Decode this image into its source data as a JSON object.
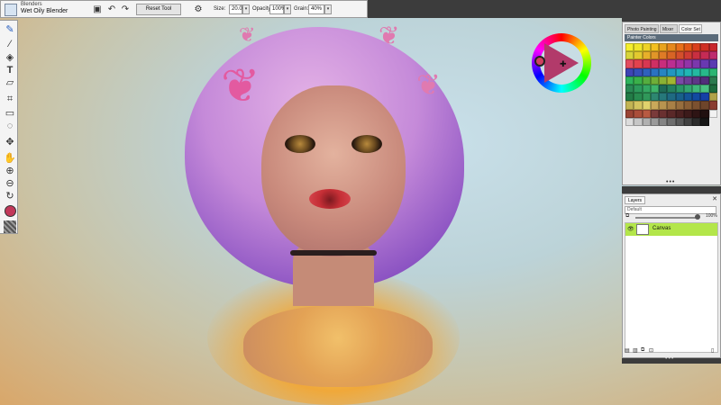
{
  "brush": {
    "category": "Blenders",
    "variant": "Wet Oily Blender",
    "icon": "brush-icon"
  },
  "propbar": {
    "reset_label": "Reset Tool",
    "size_label": "Size:",
    "size_value": "20.0",
    "opacity_label": "Opacity:",
    "opacity_value": "100%",
    "grain_label": "Grain:",
    "grain_value": "40%"
  },
  "toolbox": [
    "brush-icon",
    "dropper-icon",
    "paint-bucket-icon",
    "text-icon",
    "eraser-icon",
    "crop-icon",
    "rectangle-select-icon",
    "lasso-icon",
    "layer-adjuster-icon",
    "transform-icon",
    "grabber-icon",
    "magnifier-icon",
    "zoom-out-icon",
    "rotate-icon",
    "main-color-icon",
    "paper-icon"
  ],
  "color_panel": {
    "tabs": [
      "Photo Painting",
      "Mixer",
      "Color Set"
    ],
    "active_tab": "Color Set",
    "header": "Painter Colors",
    "swatches": [
      "#f5ef2d",
      "#f0e62a",
      "#eed327",
      "#f3c020",
      "#e8a31e",
      "#e6881c",
      "#e8701a",
      "#e25818",
      "#d9401d",
      "#cf2f24",
      "#c8262c",
      "#d8d43a",
      "#e3c92f",
      "#e7b02a",
      "#e19628",
      "#df7b26",
      "#d86425",
      "#d44f2c",
      "#cf3c34",
      "#c92f41",
      "#c52b55",
      "#be2b6e",
      "#e34c5e",
      "#e3424e",
      "#d93752",
      "#d02f63",
      "#c82d7c",
      "#bb2e91",
      "#a8309f",
      "#9234a8",
      "#7c37ad",
      "#6938b1",
      "#5a3bb2",
      "#3e44b4",
      "#3550b8",
      "#2f61bd",
      "#2a72c0",
      "#2785c1",
      "#2396c0",
      "#21a7bd",
      "#21b6b4",
      "#24b9a1",
      "#27b88a",
      "#2bb572",
      "#2eb35c",
      "#3ab04a",
      "#55ad3f",
      "#6fae38",
      "#8ab234",
      "#a2b631",
      "#7a4aa6",
      "#6c3f97",
      "#5e3688",
      "#512d7a",
      "#2b7a4e",
      "#2a8a55",
      "#2d9a5c",
      "#35a862",
      "#3fb56a",
      "#1f6b57",
      "#25805f",
      "#2b9568",
      "#34a671",
      "#3fb67a",
      "#4ac081",
      "#1d6a3c",
      "#227b46",
      "#288c50",
      "#30985a",
      "#2d8770",
      "#26787a",
      "#1f6a82",
      "#19608a",
      "#145596",
      "#124aa0",
      "#1540a6",
      "#b0a34a",
      "#c2b453",
      "#d3c45f",
      "#e0d26c",
      "#c9a95a",
      "#b8944f",
      "#a88046",
      "#976e3e",
      "#8a5f36",
      "#7c5130",
      "#6e452b",
      "#8a3c30",
      "#9a4434",
      "#aa4e3a",
      "#b85a42",
      "#7a3a3a",
      "#6a3030",
      "#5a2828",
      "#4a2020",
      "#3c1a1a",
      "#2e1414",
      "#201010",
      "#f2f2f2",
      "#dcdcdc",
      "#c6c6c6",
      "#b0b0b0",
      "#9a9a9a",
      "#848484",
      "#6e6e6e",
      "#585858",
      "#424242",
      "#2c2c2c",
      "#161616"
    ]
  },
  "layers_panel": {
    "tab": "Layers",
    "composite": "Default",
    "opacity": "100%",
    "layers": [
      {
        "name": "Canvas"
      }
    ],
    "buttons": [
      "new-layer-icon",
      "group-icon",
      "duplicate-icon",
      "lock-icon",
      "delete-icon"
    ]
  },
  "colors": {
    "active_layer": "#b3e64a",
    "main_color": "#c2385a"
  }
}
